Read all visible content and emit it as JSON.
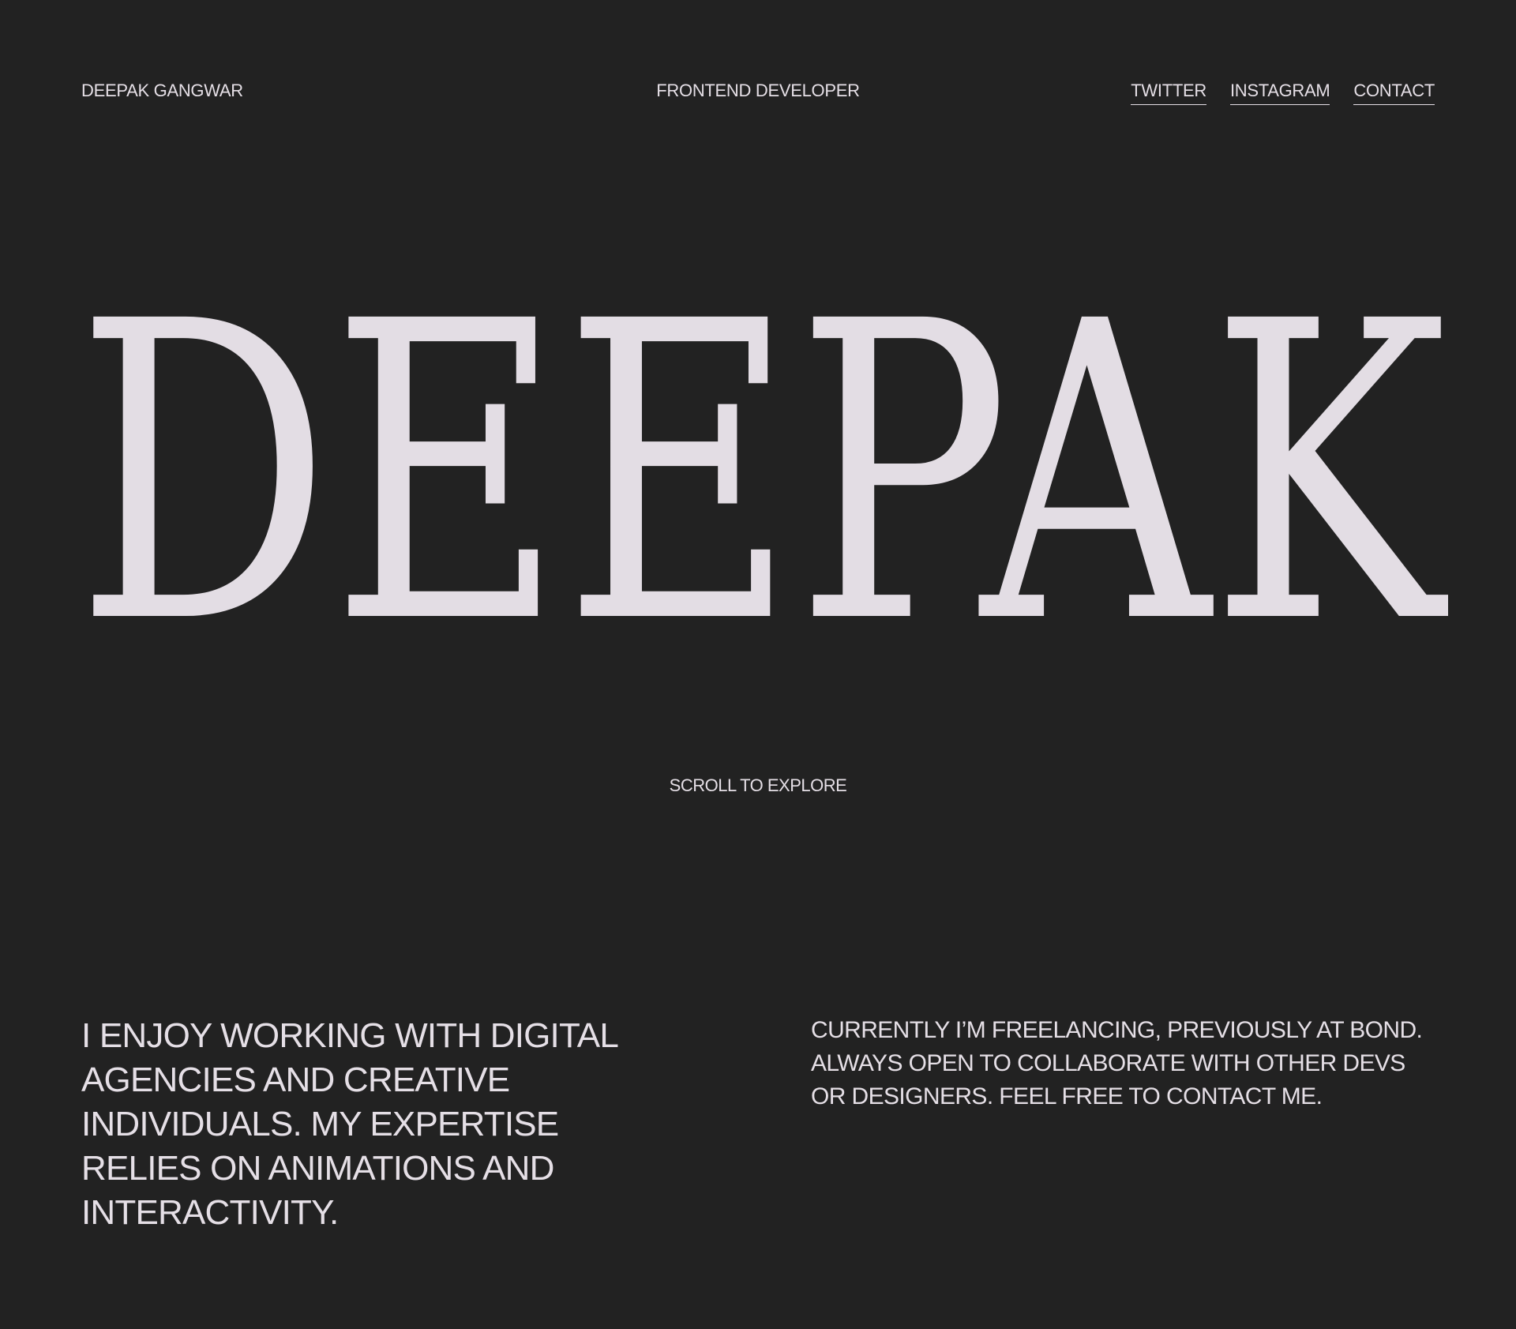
{
  "header": {
    "brand": "DEEPAK GANGWAR",
    "role": "FRONTEND DEVELOPER",
    "nav": [
      {
        "label": "TWITTER"
      },
      {
        "label": "INSTAGRAM"
      },
      {
        "label": "CONTACT"
      }
    ]
  },
  "hero": {
    "title": "DEEPAK"
  },
  "scroll_hint": "SCROLL TO EXPLORE",
  "about": {
    "left_text": "I ENJOY WORKING WITH DIGITAL AGENCIES AND CREATIVE INDIVIDUALS. MY EXPERTISE RELIES ON ANIMATIONS AND INTERACTIVITY.",
    "right_text": "CURRENTLY I’M FREELANCING, PREVIOUSLY AT BOND. ALWAYS OPEN TO COLLABORATE WITH OTHER DEVS OR DESIGNERS. FEEL FREE TO CONTACT ME."
  },
  "colors": {
    "background": "#222222",
    "text": "#e5dfe6",
    "hero": "#e3dde4"
  }
}
